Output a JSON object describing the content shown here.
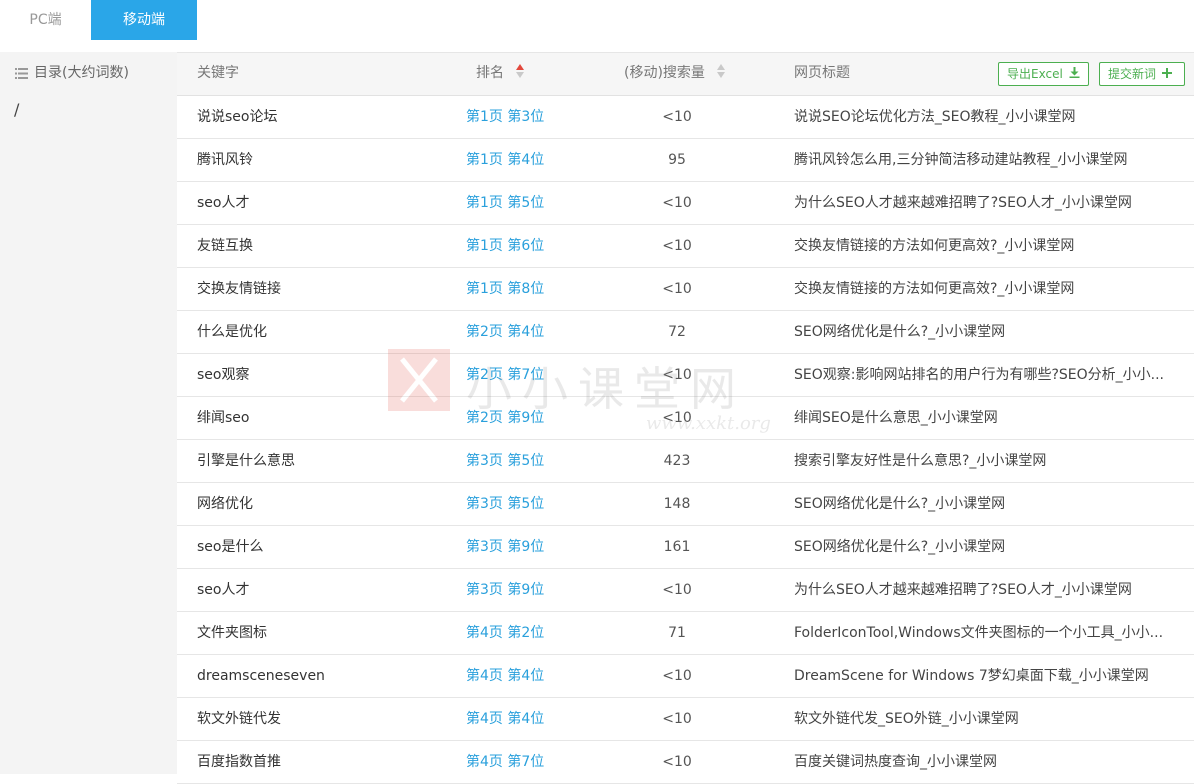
{
  "tabs": [
    {
      "label": "PC端",
      "active": false
    },
    {
      "label": "移动端",
      "active": true
    }
  ],
  "sidebar": {
    "heading": "目录(大约词数)",
    "root": "/"
  },
  "table": {
    "headers": {
      "keyword": "关键字",
      "rank": "排名",
      "volume": "(移动)搜索量",
      "title": "网页标题"
    },
    "buttons": {
      "export": "导出Excel",
      "submit": "提交新词"
    },
    "rows": [
      {
        "keyword": "说说seo论坛",
        "rank": "第1页 第3位",
        "volume": "<10",
        "title": "说说SEO论坛优化方法_SEO教程_小小课堂网"
      },
      {
        "keyword": "腾讯风铃",
        "rank": "第1页 第4位",
        "volume": "95",
        "title": "腾讯风铃怎么用,三分钟简洁移动建站教程_小小课堂网"
      },
      {
        "keyword": "seo人才",
        "rank": "第1页 第5位",
        "volume": "<10",
        "title": "为什么SEO人才越来越难招聘了?SEO人才_小小课堂网"
      },
      {
        "keyword": "友链互换",
        "rank": "第1页 第6位",
        "volume": "<10",
        "title": "交换友情链接的方法如何更高效?_小小课堂网"
      },
      {
        "keyword": "交换友情链接",
        "rank": "第1页 第8位",
        "volume": "<10",
        "title": "交换友情链接的方法如何更高效?_小小课堂网"
      },
      {
        "keyword": "什么是优化",
        "rank": "第2页 第4位",
        "volume": "72",
        "title": "SEO网络优化是什么?_小小课堂网"
      },
      {
        "keyword": "seo观察",
        "rank": "第2页 第7位",
        "volume": "<10",
        "title": "SEO观察:影响网站排名的用户行为有哪些?SEO分析_小小..."
      },
      {
        "keyword": "绯闻seo",
        "rank": "第2页 第9位",
        "volume": "<10",
        "title": "绯闻SEO是什么意思_小小课堂网"
      },
      {
        "keyword": "引擎是什么意思",
        "rank": "第3页 第5位",
        "volume": "423",
        "title": "搜索引擎友好性是什么意思?_小小课堂网"
      },
      {
        "keyword": "网络优化",
        "rank": "第3页 第5位",
        "volume": "148",
        "title": "SEO网络优化是什么?_小小课堂网"
      },
      {
        "keyword": "seo是什么",
        "rank": "第3页 第9位",
        "volume": "161",
        "title": "SEO网络优化是什么?_小小课堂网"
      },
      {
        "keyword": "seo人才",
        "rank": "第3页 第9位",
        "volume": "<10",
        "title": "为什么SEO人才越来越难招聘了?SEO人才_小小课堂网"
      },
      {
        "keyword": "文件夹图标",
        "rank": "第4页 第2位",
        "volume": "71",
        "title": "FolderIconTool,Windows文件夹图标的一个小工具_小小..."
      },
      {
        "keyword": "dreamsceneseven",
        "rank": "第4页 第4位",
        "volume": "<10",
        "title": "DreamScene for Windows 7梦幻桌面下载_小小课堂网"
      },
      {
        "keyword": "软文外链代发",
        "rank": "第4页 第4位",
        "volume": "<10",
        "title": "软文外链代发_SEO外链_小小课堂网"
      },
      {
        "keyword": "百度指数首推",
        "rank": "第4页 第7位",
        "volume": "<10",
        "title": "百度关键词热度查询_小小课堂网"
      }
    ]
  },
  "watermark": {
    "brand": "小小课堂网",
    "url": "www.xxkt.org"
  },
  "colors": {
    "accent": "#2aa6e8",
    "link": "#2aa0dc",
    "button_green": "#4caf50",
    "sort_active": "#e2483c",
    "sidebar_bg": "#f4f4f4"
  }
}
